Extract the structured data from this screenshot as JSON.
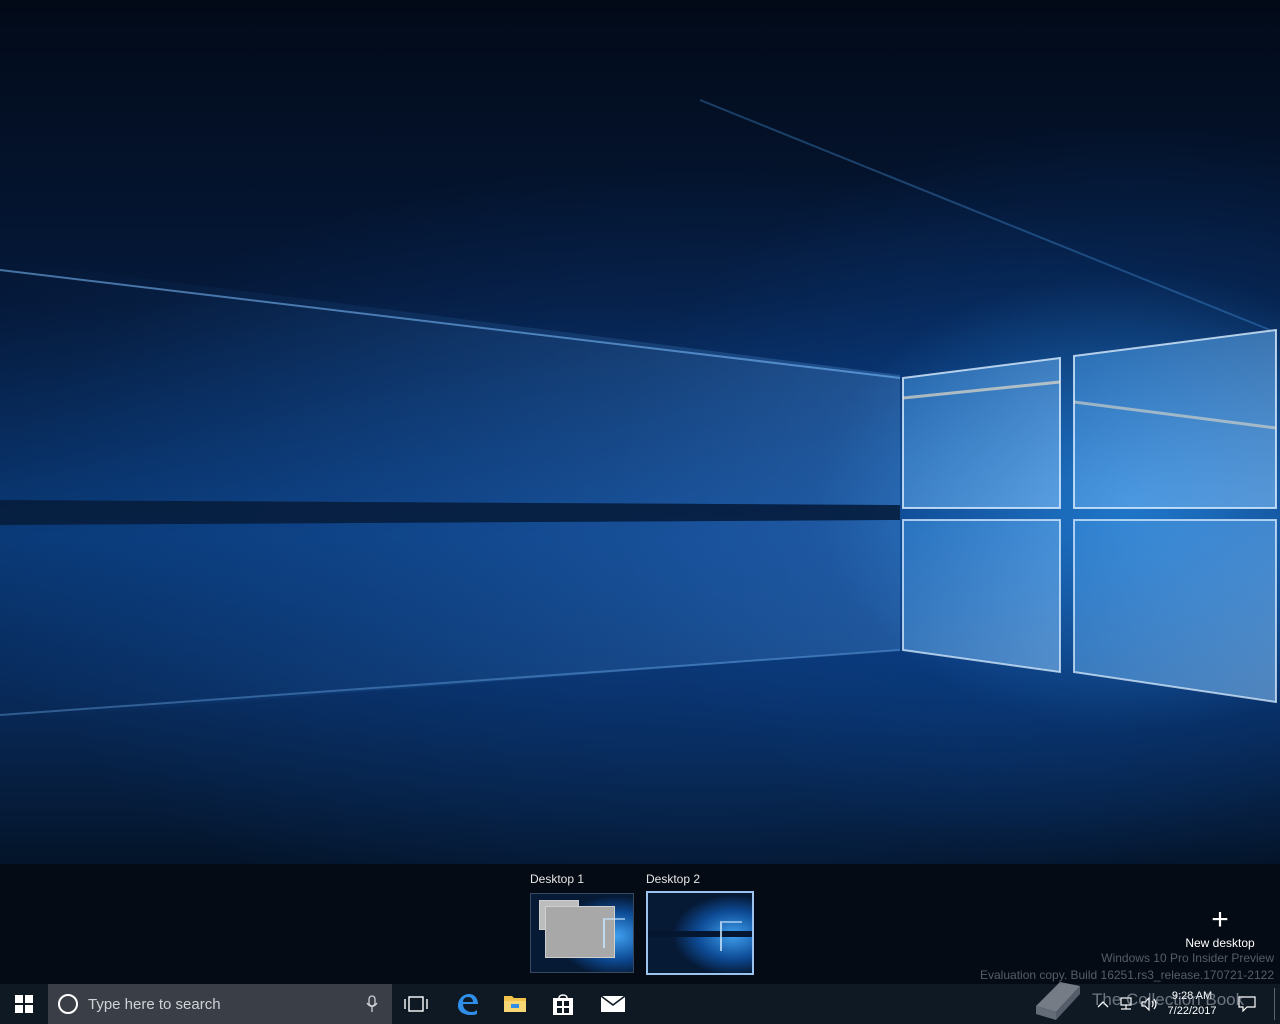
{
  "task_view": {
    "desktops": [
      {
        "label": "Desktop 1",
        "active": false
      },
      {
        "label": "Desktop 2",
        "active": true
      }
    ],
    "new_desktop": {
      "label": "New desktop",
      "icon": "plus-icon"
    }
  },
  "watermark": {
    "line1": "Windows 10 Pro Insider Preview",
    "line2": "Evaluation copy. Build 16251.rs3_release.170721-2122"
  },
  "overlay_brand": {
    "text": "The Collection Book"
  },
  "taskbar": {
    "search_placeholder": "Type here to search",
    "pinned_apps": [
      "edge-icon",
      "file-explorer-icon",
      "store-icon",
      "mail-icon"
    ]
  },
  "tray": {
    "time": "9:28 AM",
    "date": "7/22/2017"
  },
  "colors": {
    "taskbar_bg": "#0f1924",
    "search_bg": "#3a3f47",
    "active_desktop_border": "#9cc3ee",
    "accent": "#0a78d7"
  }
}
